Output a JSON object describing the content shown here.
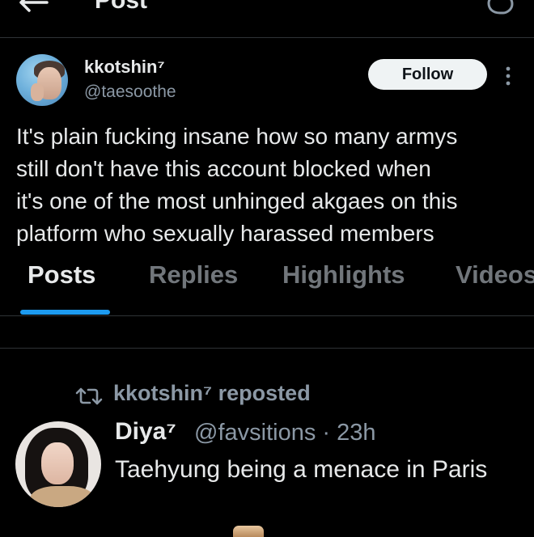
{
  "header": {
    "title": "Post"
  },
  "author": {
    "display_name": "kkotshin⁷",
    "handle": "@taesoothe",
    "follow_label": "Follow"
  },
  "post": {
    "lines": [
      "It's plain fucking insane how so many armys",
      "still don't have this account blocked when",
      "it's one of the most unhinged akgaes on this",
      "platform who sexually harassed members"
    ]
  },
  "tabs": [
    {
      "label": "Posts",
      "active": true
    },
    {
      "label": "Replies",
      "active": false
    },
    {
      "label": "Highlights",
      "active": false
    },
    {
      "label": "Videos",
      "active": false
    }
  ],
  "repost": {
    "label": "kkotshin⁷ reposted",
    "author_name": "Diya⁷",
    "author_meta": "@favsitions · 23h",
    "text": "Taehyung being a menace in Paris"
  },
  "colors": {
    "background": "#000000",
    "accent": "#1d9bf0",
    "text_primary": "#e7e9ea",
    "text_secondary": "#71767b"
  },
  "icons": {
    "back": "arrow-left-icon",
    "reply": "reply-icon",
    "more": "more-vertical-icon",
    "repost": "repost-icon"
  }
}
